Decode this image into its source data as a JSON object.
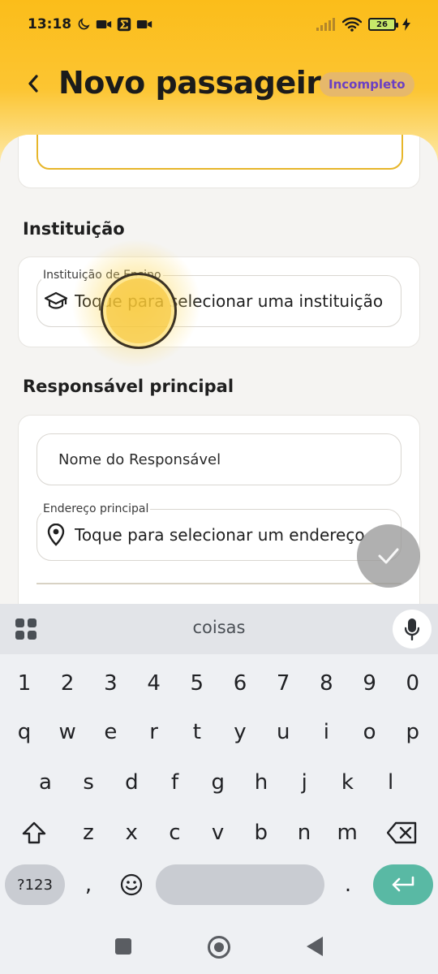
{
  "status_bar": {
    "time": "13:18",
    "battery_level": "26",
    "left_icons": [
      "moon-icon",
      "video-camera-icon",
      "sigma-icon",
      "video-camera-icon"
    ],
    "right_icons": [
      "signal-icon",
      "wifi-icon",
      "battery-icon",
      "charging-bolt-icon"
    ]
  },
  "header": {
    "title": "Novo passageiro",
    "status_badge": "Incompleto",
    "back_icon": "chevron-left-icon",
    "colors": {
      "accent": "#fbbd1a",
      "badge_bg": "#e6b86b",
      "badge_text": "#6b3fc4"
    }
  },
  "sections": {
    "institution": {
      "label": "Instituição",
      "field_label": "Instituição de Ensino",
      "field_placeholder": "Toque para selecionar uma instituição",
      "icon": "graduation-cap-icon"
    },
    "guardian": {
      "label": "Responsável principal",
      "name_placeholder": "Nome do Responsável",
      "address_label": "Endereço principal",
      "address_placeholder": "Toque para selecionar um endereço",
      "address_icon": "location-pin-icon"
    }
  },
  "fab": {
    "icon": "check-icon"
  },
  "keyboard": {
    "suggestion": "coisas",
    "row_numbers": [
      "1",
      "2",
      "3",
      "4",
      "5",
      "6",
      "7",
      "8",
      "9",
      "0"
    ],
    "row_1": [
      "q",
      "w",
      "e",
      "r",
      "t",
      "y",
      "u",
      "i",
      "o",
      "p"
    ],
    "row_2": [
      "a",
      "s",
      "d",
      "f",
      "g",
      "h",
      "j",
      "k",
      "l"
    ],
    "row_3": [
      "z",
      "x",
      "c",
      "v",
      "b",
      "n",
      "m"
    ],
    "symbols_key": "?123",
    "comma_key": ",",
    "period_key": ".",
    "colors": {
      "enter": "#59b9a4"
    }
  }
}
